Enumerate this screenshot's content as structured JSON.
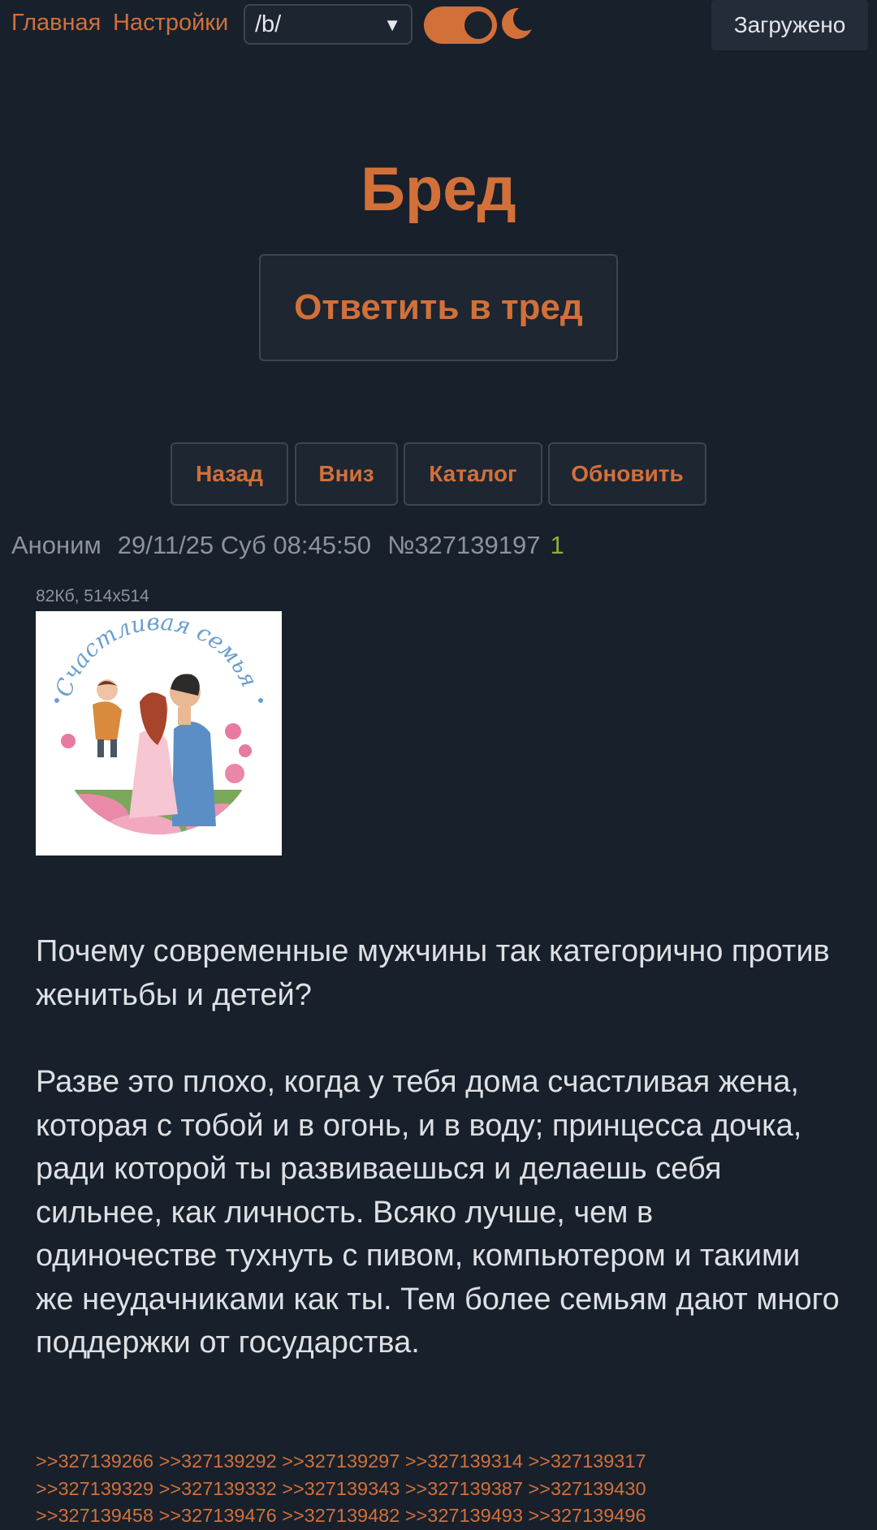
{
  "header": {
    "nav": [
      "Главная",
      "Настройки"
    ],
    "board_select": {
      "value": "/b/",
      "arrow": "▼"
    },
    "theme_toggle": {
      "on": true,
      "icon": "moon-icon"
    },
    "status": "Загружено"
  },
  "thread": {
    "title": "Бред",
    "reply_button": "Ответить в тред",
    "nav_buttons": [
      "Назад",
      "Вниз",
      "Каталог",
      "Обновить"
    ]
  },
  "post": {
    "author": "Аноним",
    "datetime": "29/11/25 Суб 08:45:50",
    "number": "№327139197",
    "reply_count": "1",
    "file_info": "82Кб, 514x514",
    "image_caption": "Счастливая семья",
    "paragraphs": [
      "Почему современные мужчины так категорично против женитьбы и детей?",
      "Разве это плохо, когда у тебя дома счастливая жена, которая с тобой и в огонь, и в воду; принцесса дочка, ради которой ты развиваешься и делаешь себя сильнее, как личность. Всяко лучше, чем в одиночестве тухнуть с пивом, компьютером и такими же неудачниками как ты. Тем более семьям дают много поддержки от государства."
    ],
    "replies": [
      ">>327139266",
      ">>327139292",
      ">>327139297",
      ">>327139314",
      ">>327139317",
      ">>327139329",
      ">>327139332",
      ">>327139343",
      ">>327139387",
      ">>327139430",
      ">>327139458",
      ">>327139476",
      ">>327139482",
      ">>327139493",
      ">>327139496"
    ]
  },
  "colors": {
    "background": "#18202b",
    "accent": "#d2703a",
    "muted_text": "#8c939c",
    "reply_count": "#8fae3a"
  }
}
